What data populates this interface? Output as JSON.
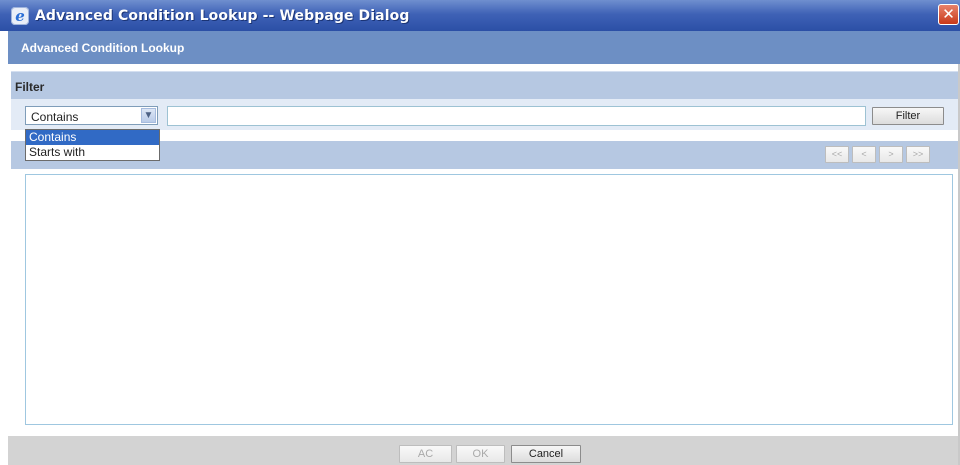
{
  "window": {
    "title": "Advanced Condition Lookup -- Webpage Dialog",
    "app_icon": "internet-explorer-icon",
    "close_glyph": "✕"
  },
  "dialog": {
    "header": "Advanced Condition Lookup"
  },
  "filter": {
    "section_label": "Filter",
    "select_value": "Contains",
    "input_value": "",
    "button_label": "Filter",
    "options": [
      "Contains",
      "Starts with"
    ]
  },
  "pager": {
    "first": "<<",
    "prev": "<",
    "next": ">",
    "last": ">>"
  },
  "footer": {
    "ac_label": "AC",
    "ok_label": "OK",
    "cancel_label": "Cancel"
  },
  "colors": {
    "titlebar": "#3f62b6",
    "header": "#6d8fc4",
    "section": "#b6c8e2",
    "selected_option": "#316ac5"
  }
}
